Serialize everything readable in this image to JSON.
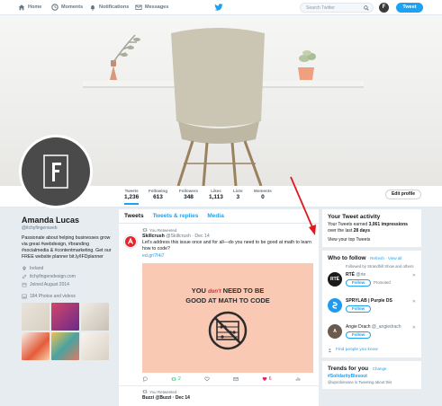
{
  "nav": {
    "home": "Home",
    "moments": "Moments",
    "notifications": "Notifications",
    "messages": "Messages",
    "search_placeholder": "Search Twitter",
    "avatar_letter": "F",
    "tweet_button": "Tweet"
  },
  "stats": [
    {
      "label": "Tweets",
      "value": "1,236"
    },
    {
      "label": "Following",
      "value": "613"
    },
    {
      "label": "Followers",
      "value": "348"
    },
    {
      "label": "Likes",
      "value": "1,113"
    },
    {
      "label": "Lists",
      "value": "3"
    },
    {
      "label": "Moments",
      "value": "0"
    }
  ],
  "edit_profile": "Edit profile",
  "profile": {
    "avatar_letter": "F",
    "name": "Amanda Lucas",
    "handle": "@itchyfingersweb",
    "bio": "Passionate about helping businesses grow via great #webdesign, #branding #socialmedia & #contentmarketing. Get our FREE website planner bit.ly/IFDplanner",
    "location": "Ireland",
    "website": "itchyfingersdesign.com",
    "joined": "Joined August 2014",
    "photos": "184 Photos and videos"
  },
  "timeline": {
    "tabs": [
      "Tweets",
      "Tweets & replies",
      "Media"
    ],
    "tweet1": {
      "retweeted": "You Retweeted",
      "name": "Skillcrush",
      "meta": "@Skillcrush · Dec 14",
      "text": "Let's address this issue once and for all—do you need to be good at math to learn how to code?",
      "link": "ed.gr/7f4i7",
      "card_text_a": "YOU",
      "card_text_dont": "don't",
      "card_text_b": "NEED TO BE",
      "card_text_c": "GOOD AT MATH TO CODE",
      "retweets": "2",
      "likes": "6"
    },
    "tweet2": {
      "retweeted": "You Retweeted",
      "preview": "Buzzi  @Buzzi · Dec 14"
    }
  },
  "activity": {
    "title": "Your Tweet activity",
    "body_a": "Your Tweets earned ",
    "impressions": "3,061 impressions",
    "body_b": " over the last ",
    "days": "28 days",
    "link": "View your top Tweets"
  },
  "wtf": {
    "title": "Who to follow",
    "refresh": "· Refresh · View all",
    "note": "Followed by Strandhill Show and others",
    "follow": "Follow",
    "promoted": "Promoted",
    "accounts": [
      {
        "name": "RTÉ",
        "handle": "@rte",
        "avatar": "RTÉ",
        "color": "#1b1b1b"
      },
      {
        "name": "SPRYLAB | Purple DS",
        "handle": "@sprylab",
        "avatar": "S",
        "color": "#1d9bf0"
      },
      {
        "name": "Angie Drach",
        "handle": "@_angiedrach",
        "avatar": "A",
        "color": "#6b5a4e"
      }
    ],
    "find": "Find people you know"
  },
  "trends": {
    "title": "Trends for you",
    "change": "· Change",
    "tag": "#SolidarityBlesout",
    "sub": "@wprobinsane is Tweeting about this"
  }
}
